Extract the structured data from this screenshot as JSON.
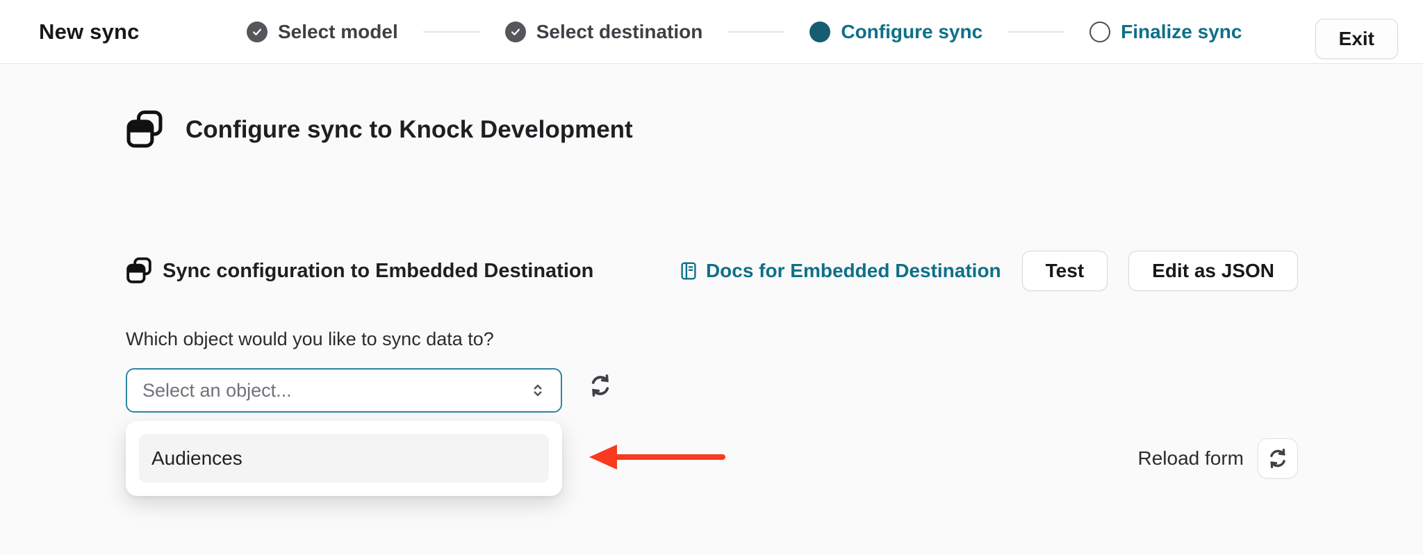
{
  "header": {
    "app_title": "New sync",
    "steps": [
      {
        "label": "Select model",
        "state": "complete"
      },
      {
        "label": "Select destination",
        "state": "complete"
      },
      {
        "label": "Configure sync",
        "state": "current"
      },
      {
        "label": "Finalize sync",
        "state": "upcoming"
      }
    ],
    "exit_button": "Exit"
  },
  "main": {
    "page_title": "Configure sync to Knock Development",
    "section": {
      "title": "Sync configuration to Embedded Destination",
      "docs_link": "Docs for Embedded Destination",
      "test_button": "Test",
      "edit_json_button": "Edit as JSON"
    },
    "object_field": {
      "label": "Which object would you like to sync data to?",
      "placeholder": "Select an object...",
      "options": [
        "Audiences"
      ]
    },
    "reload": {
      "label": "Reload form"
    }
  },
  "icons": {
    "step_complete": "check-icon",
    "step_current": "filled-circle-icon",
    "step_upcoming": "empty-circle-icon",
    "page_title": "stacked-windows-icon",
    "docs": "book-icon",
    "select": "chevron-up-down-icon",
    "refresh": "refresh-arrows-icon",
    "annotation": "red-arrow-left-icon"
  },
  "colors": {
    "accent_teal_text": "#0e7088",
    "step_current_fill": "#175d72",
    "step_complete_fill": "#55555b",
    "select_focus_border": "#2e85a0",
    "annotation_arrow": "#f93a1e",
    "header_background": "#ffffff",
    "page_background": "#fafafa",
    "option_hover_background": "#f4f4f5"
  }
}
